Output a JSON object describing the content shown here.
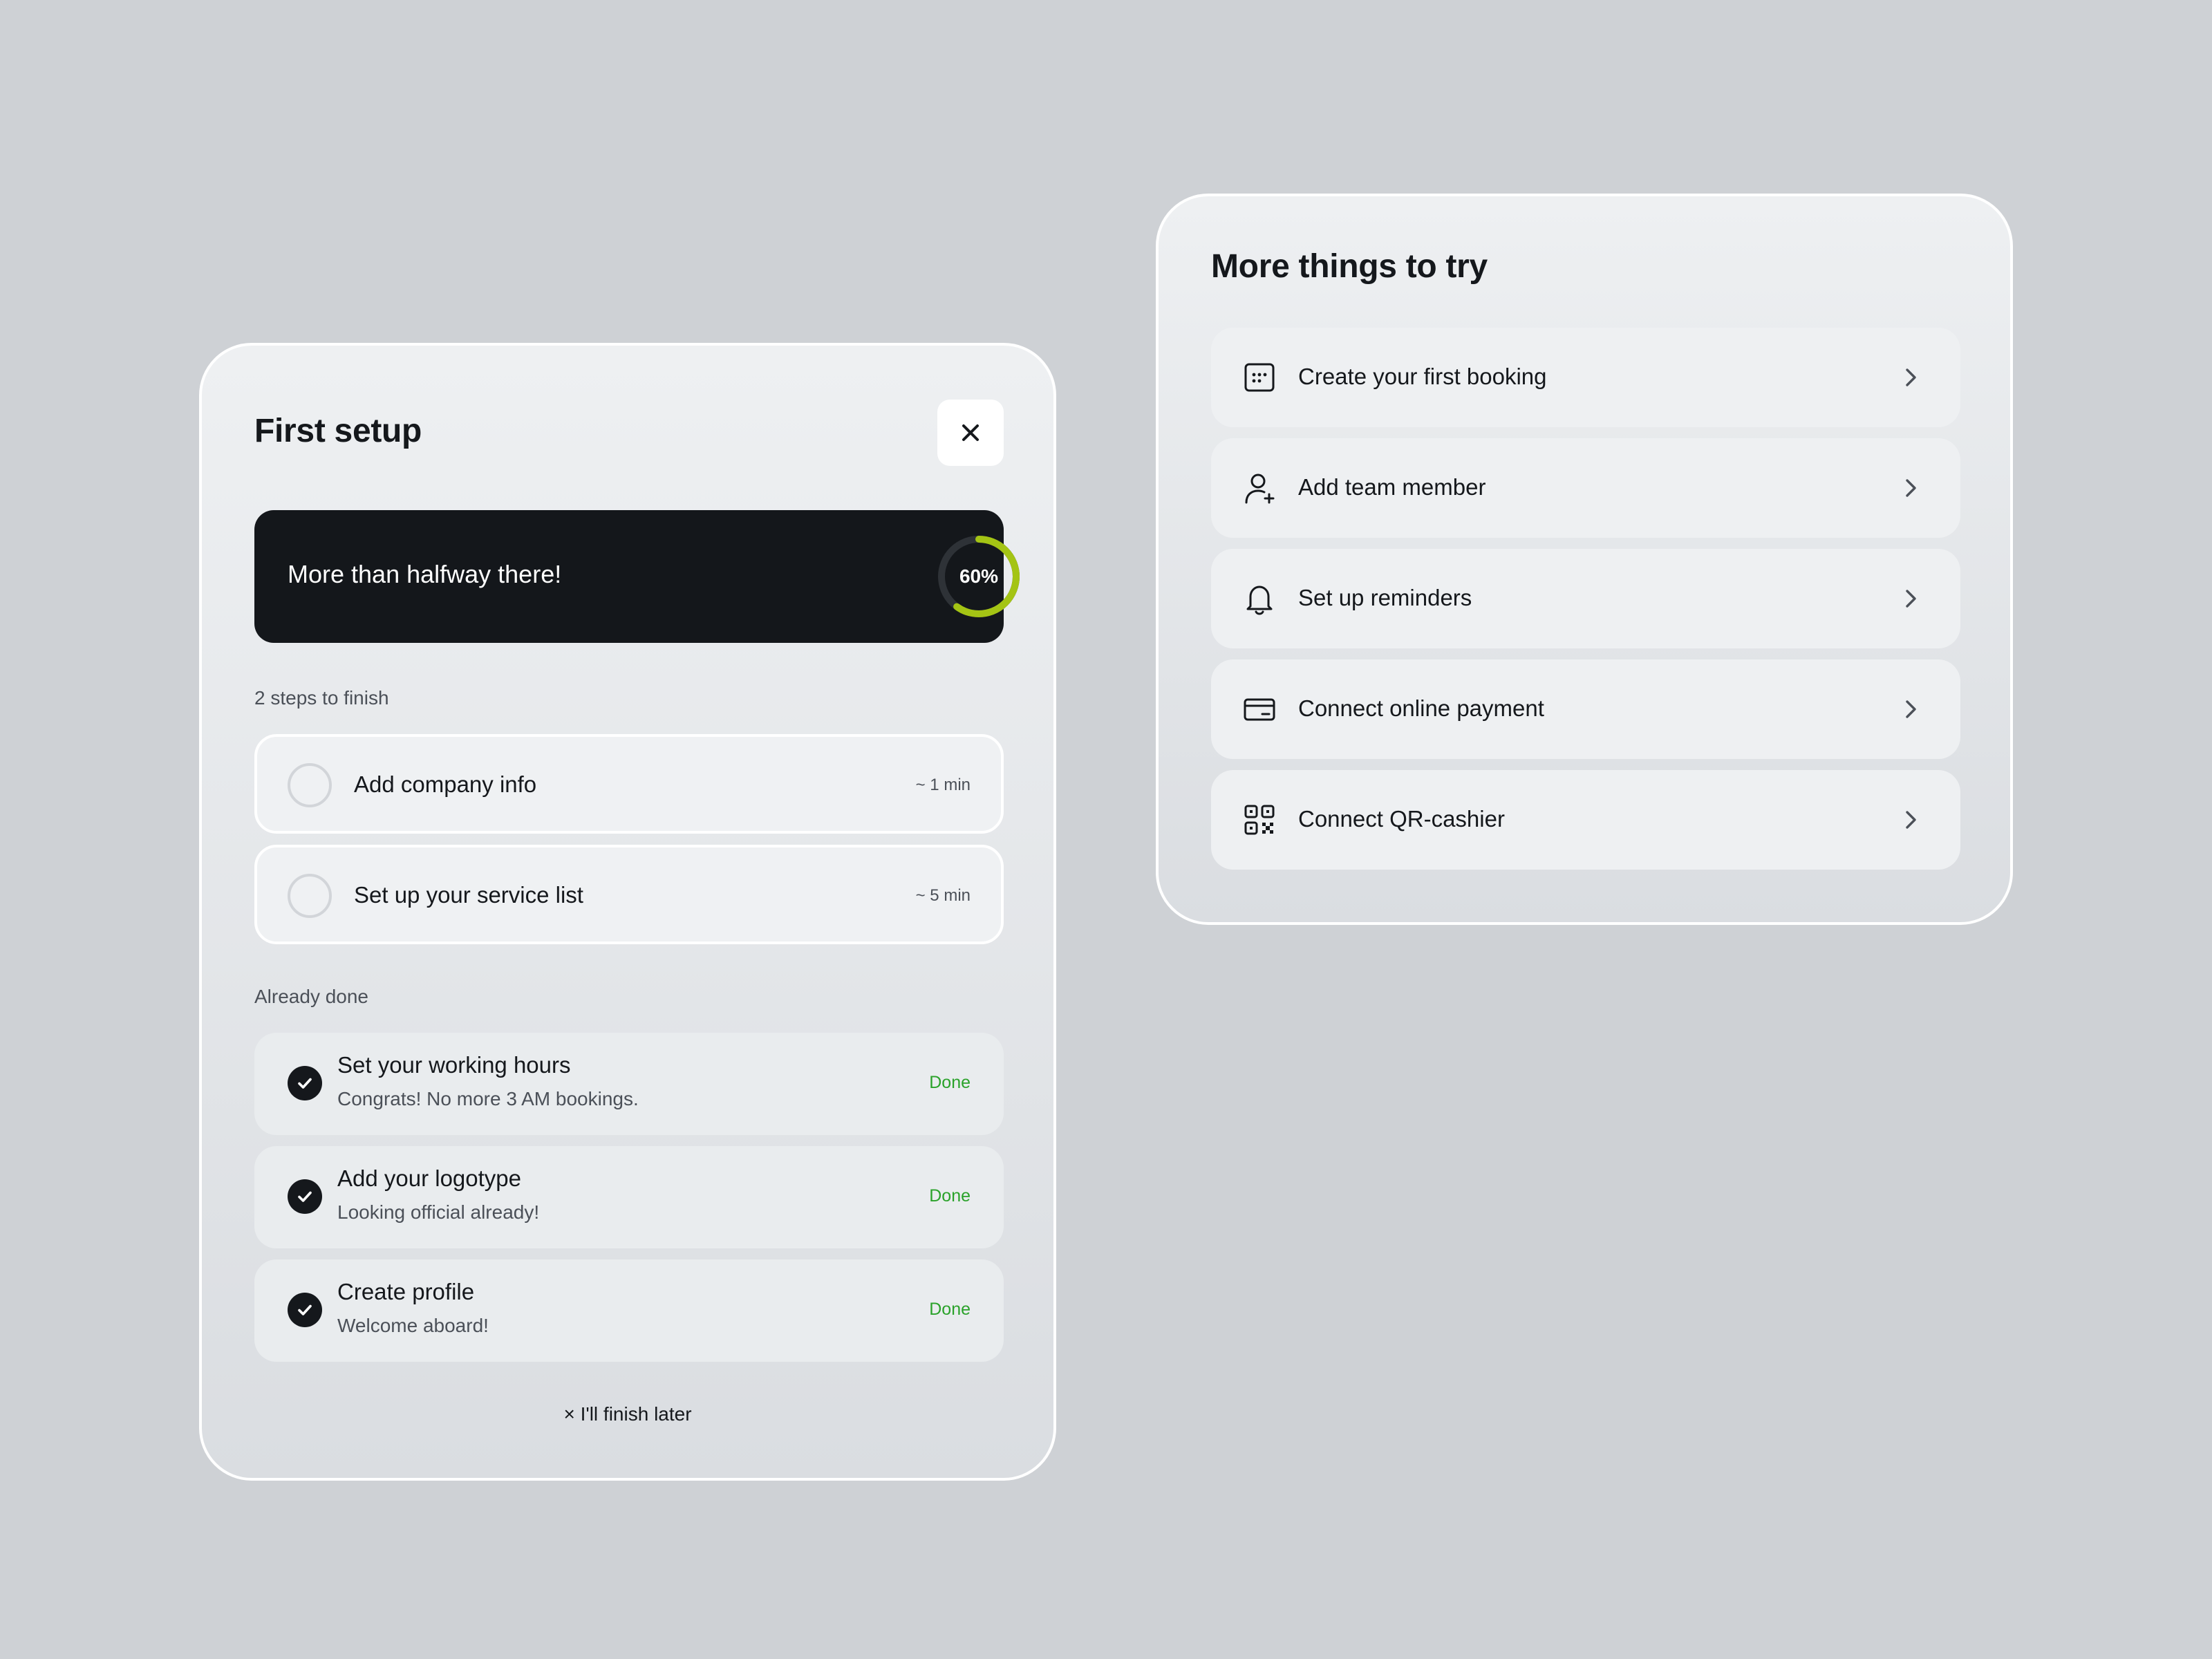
{
  "setup": {
    "title": "First setup",
    "close_label": "Close",
    "progress": {
      "message": "More than halfway there!",
      "percent_label": "60%",
      "value": 0.6,
      "accent_color": "#a4c414"
    },
    "remaining_label": "2 steps to finish",
    "todo": [
      {
        "label": "Add company info",
        "time": "~ 1 min"
      },
      {
        "label": "Set up your service list",
        "time": "~ 5 min"
      }
    ],
    "done_label": "Already done",
    "done": [
      {
        "title": "Set your working hours",
        "subtitle": "Congrats! No more 3 AM bookings.",
        "status": "Done"
      },
      {
        "title": "Add your logotype",
        "subtitle": "Looking official already!",
        "status": "Done"
      },
      {
        "title": "Create profile",
        "subtitle": "Welcome aboard!",
        "status": "Done"
      }
    ],
    "done_color": "#2aa22a",
    "finish_later": "× I'll finish later"
  },
  "try": {
    "title": "More things to try",
    "items": [
      {
        "label": "Create your first booking",
        "icon": "calendar-icon"
      },
      {
        "label": "Add team member",
        "icon": "user-plus-icon"
      },
      {
        "label": "Set up reminders",
        "icon": "bell-icon"
      },
      {
        "label": "Connect online payment",
        "icon": "credit-card-icon"
      },
      {
        "label": "Connect QR-cashier",
        "icon": "qr-code-icon"
      }
    ]
  }
}
